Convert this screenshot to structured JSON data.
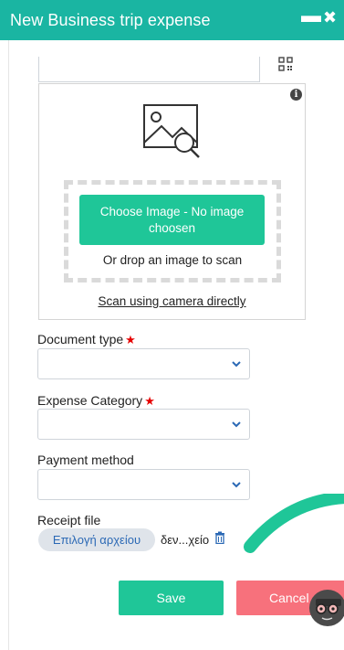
{
  "window": {
    "title": "New Business trip expense",
    "minimize_glyph": "▬",
    "close_glyph": "✖"
  },
  "qr_icon": "qr-code-icon",
  "scanner": {
    "info_glyph": "i",
    "choose_button": "Choose Image - No image choosen",
    "drop_text": "Or drop an image to scan",
    "camera_link": "Scan using camera directly"
  },
  "form": {
    "document_type": {
      "label": "Document type",
      "required_mark": "★",
      "value": ""
    },
    "expense_category": {
      "label": "Expense Category",
      "required_mark": "★",
      "value": ""
    },
    "payment_method": {
      "label": "Payment method",
      "value": ""
    },
    "receipt_file": {
      "label": "Receipt file",
      "choose_button": "Επιλογή αρχείου",
      "file_name": "δεν...χείο"
    }
  },
  "actions": {
    "save": "Save",
    "cancel": "Cancel"
  },
  "colors": {
    "header": "#1ab5a2",
    "primary": "#1fc698",
    "cancel": "#f7717c",
    "required": "#e60000",
    "link": "#2b69b5"
  }
}
